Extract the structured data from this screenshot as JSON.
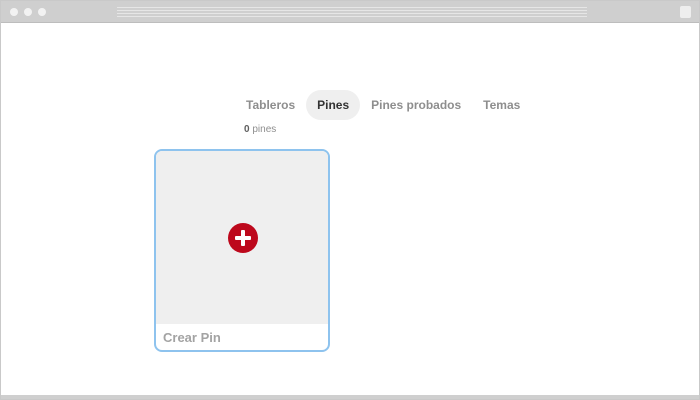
{
  "tabs": [
    {
      "label": "Tableros",
      "active": false
    },
    {
      "label": "Pines",
      "active": true
    },
    {
      "label": "Pines probados",
      "active": false
    },
    {
      "label": "Temas",
      "active": false
    }
  ],
  "pin_count": {
    "number": "0",
    "unit": "pines"
  },
  "create_card": {
    "label": "Crear Pin",
    "icon": "plus-circle-icon",
    "icon_color": "#bd081c"
  },
  "colors": {
    "accent": "#bd081c",
    "card_border": "#8ec3ee",
    "active_tab_bg": "#efefef"
  }
}
